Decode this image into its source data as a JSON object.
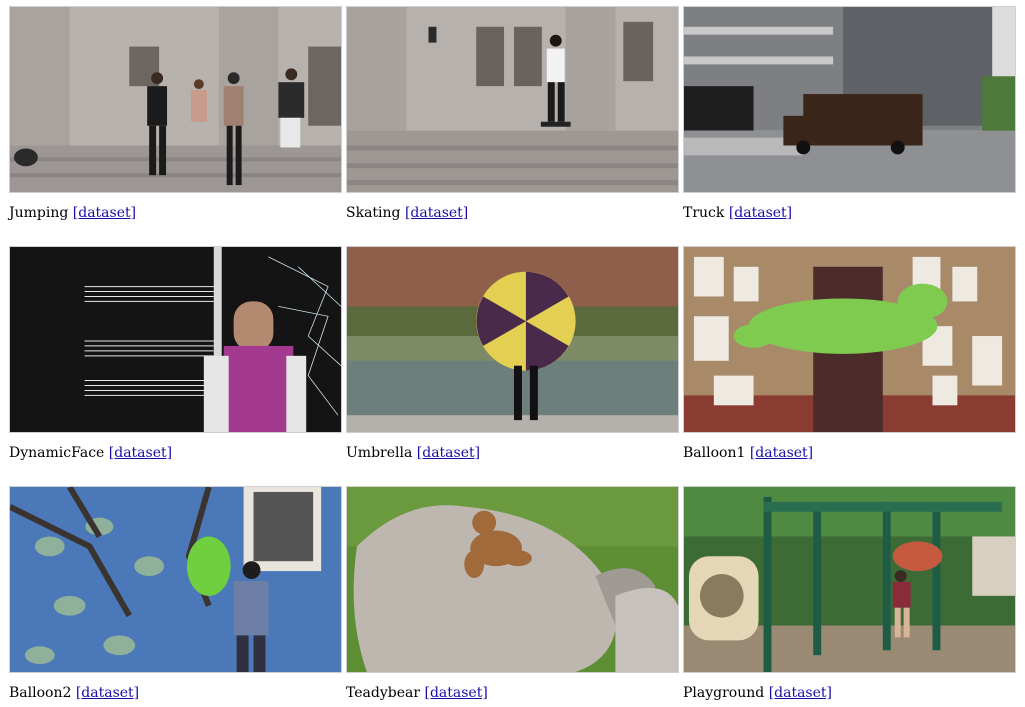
{
  "gallery": {
    "link_label": "[dataset]",
    "items": [
      {
        "name": "Jumping"
      },
      {
        "name": "Skating"
      },
      {
        "name": "Truck"
      },
      {
        "name": "DynamicFace"
      },
      {
        "name": "Umbrella"
      },
      {
        "name": "Balloon1"
      },
      {
        "name": "Balloon2"
      },
      {
        "name": "Teadybear"
      },
      {
        "name": "Playground"
      }
    ]
  }
}
